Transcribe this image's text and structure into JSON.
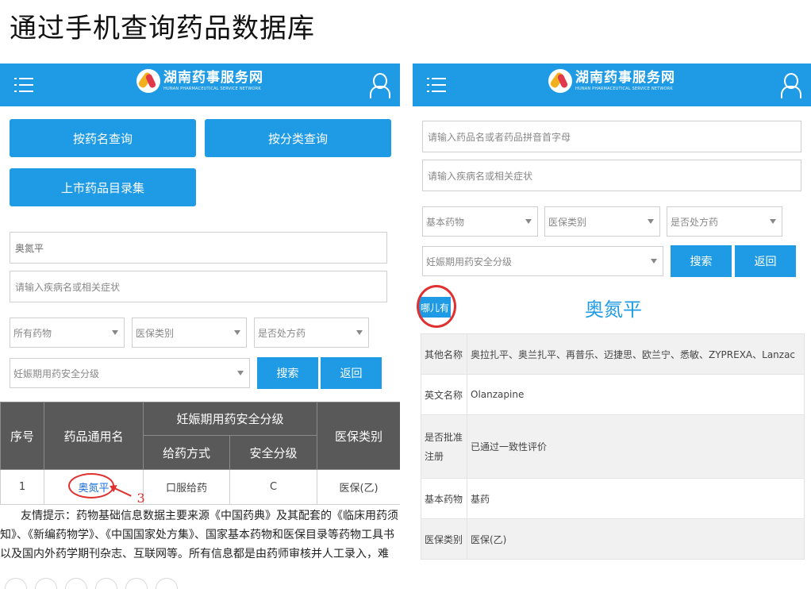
{
  "title": "通过手机查询药品数据库",
  "app": {
    "name": "湖南药事服务网",
    "subtitle": "HUNAN PHARMACEUTICAL SERVICE NETWORK"
  },
  "left": {
    "buttons": {
      "by_name": "按药名查询",
      "by_category": "按分类查询",
      "catalog": "上市药品目录集"
    },
    "drug_input": {
      "value": "奥氮平"
    },
    "symptom_input": {
      "placeholder": "请输入疾病名或相关症状"
    },
    "selects": [
      "所有药物",
      "医保类别",
      "是否处方药",
      "妊娠期用药安全分级"
    ],
    "search": "搜索",
    "back": "返回",
    "table": {
      "h_index": "序号",
      "h_name": "药品通用名",
      "h_preg": "妊娠期用药安全分级",
      "h_route": "给药方式",
      "h_safety": "安全分级",
      "h_insurance": "医保类别",
      "row": {
        "index": "1",
        "name": "奥氮平",
        "route": "口服给药",
        "safety": "C",
        "insurance": "医保(乙)"
      }
    },
    "annotation": "3",
    "tip": "友情提示：药物基础信息数据主要来源《中国药典》及其配套的《临床用药须知》、《新编药物学》、《中国国家处方集》、国家基本药物和医保目录等药物工具书以及国内外药学期刊杂志、互联网等。所有信息都是由药师审核并人工录入，难免会出现误差，欢迎广"
  },
  "right": {
    "name_input": {
      "placeholder": "请输入药品名或者药品拼音首字母"
    },
    "symptom_input": {
      "placeholder": "请输入疾病名或相关症状"
    },
    "selects": [
      "基本药物",
      "医保类别",
      "是否处方药",
      "妊娠期用药安全分级"
    ],
    "search": "搜索",
    "back": "返回",
    "where": "哪儿有",
    "drug_title": "奥氮平",
    "info": [
      {
        "k": "其他名称",
        "v": "奥拉扎平、奥兰扎平、再普乐、迈捷思、欧兰宁、悉敏、ZYPREXA、Lanzac"
      },
      {
        "k": "英文名称",
        "v": "Olanzapine"
      },
      {
        "k": "是否批准注册",
        "v": "已通过一致性评价"
      },
      {
        "k": "基本药物",
        "v": "基药"
      },
      {
        "k": "医保类别",
        "v": "医保(乙)"
      }
    ]
  }
}
